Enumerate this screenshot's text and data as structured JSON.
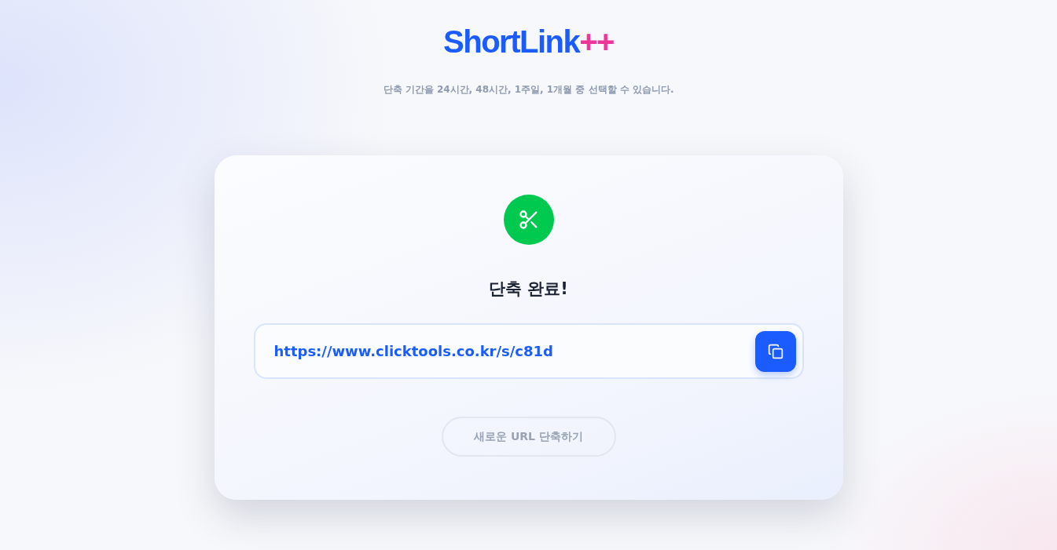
{
  "logo": {
    "name": "ShortLink",
    "suffix": "++"
  },
  "subtitle": "단축 기간을 24시간, 48시간, 1주일, 1개월 중 선택할 수 있습니다.",
  "card": {
    "title": "단축 완료!",
    "short_url": "https://www.clicktools.co.kr/s/c81d",
    "new_button": "새로운 URL 단축하기"
  }
}
